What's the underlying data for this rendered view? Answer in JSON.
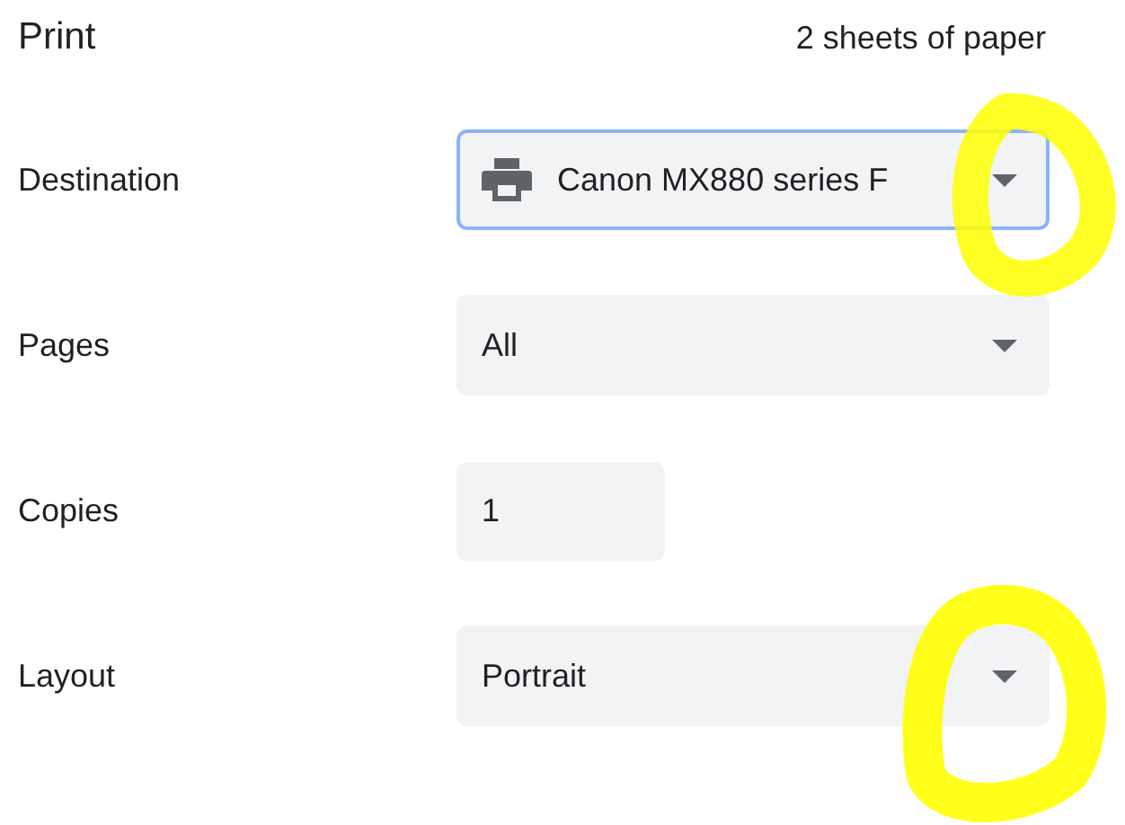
{
  "header": {
    "title": "Print",
    "summary": "2 sheets of paper"
  },
  "settings": [
    {
      "label": "Destination",
      "kind": "printer-select",
      "value": "Canon MX880 series F",
      "focused": true
    },
    {
      "label": "Pages",
      "kind": "select",
      "value": "All",
      "focused": false
    },
    {
      "label": "Copies",
      "kind": "number",
      "value": "1",
      "focused": false
    },
    {
      "label": "Layout",
      "kind": "select",
      "value": "Portrait",
      "focused": false
    }
  ]
}
